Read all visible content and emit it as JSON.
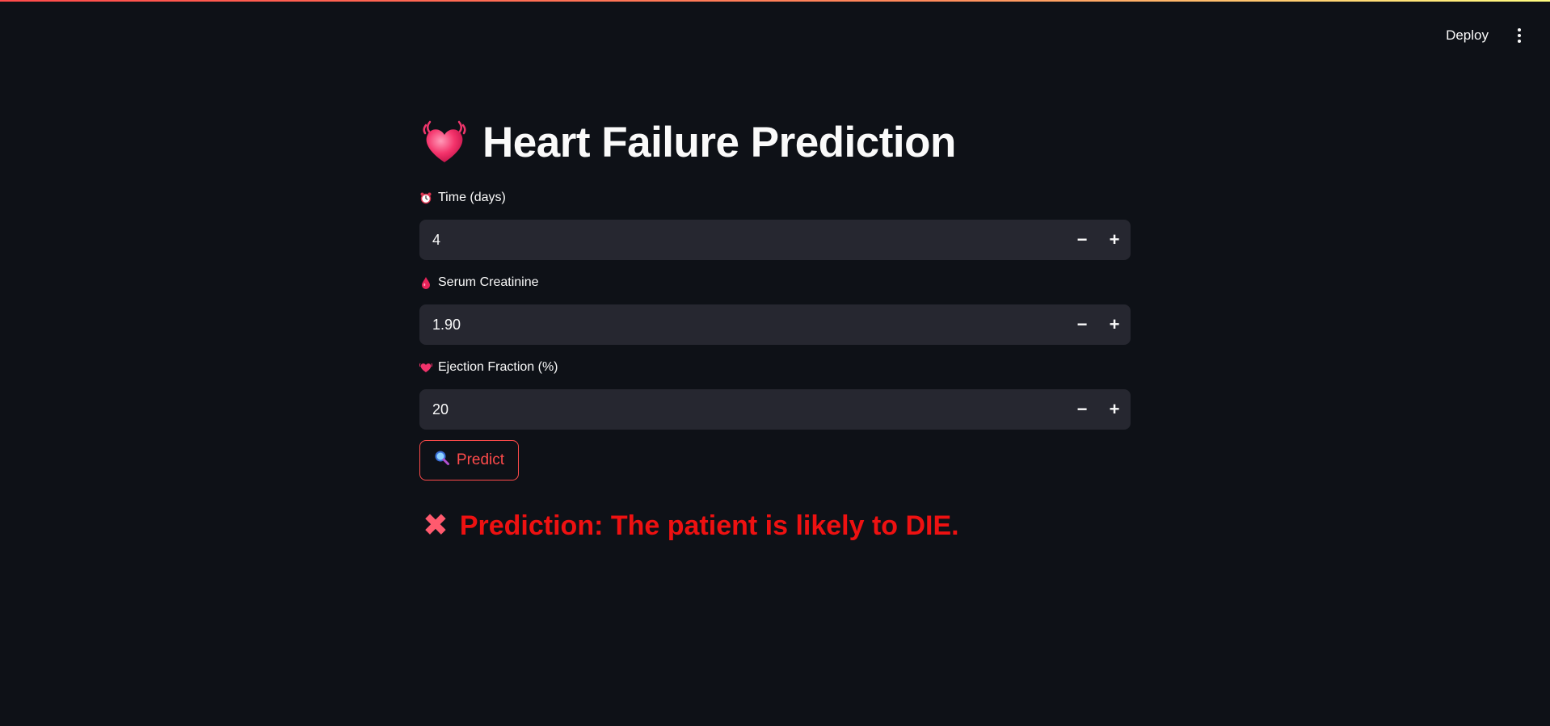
{
  "header": {
    "deploy_label": "Deploy",
    "menu_icon": "kebab-menu-icon"
  },
  "page": {
    "title": "Heart Failure Prediction",
    "title_icon": "beating-heart-icon"
  },
  "fields": [
    {
      "label": "Time (days)",
      "icon": "alarm-clock-icon",
      "value": "4",
      "minus": "−",
      "plus": "+"
    },
    {
      "label": "Serum Creatinine",
      "icon": "blood-drop-icon",
      "value": "1.90",
      "minus": "−",
      "plus": "+"
    },
    {
      "label": "Ejection Fraction (%)",
      "icon": "heart-icon",
      "value": "20",
      "minus": "−",
      "plus": "+"
    }
  ],
  "predict_button": {
    "label": "Predict",
    "icon": "magnifier-icon"
  },
  "result": {
    "icon_glyph": "✖",
    "icon": "cross-mark-icon",
    "text": "Prediction: The patient is likely to DIE."
  },
  "colors": {
    "background": "#0e1117",
    "input_bg": "#262730",
    "accent": "#ff4b4b",
    "result_red": "#ee1111"
  }
}
